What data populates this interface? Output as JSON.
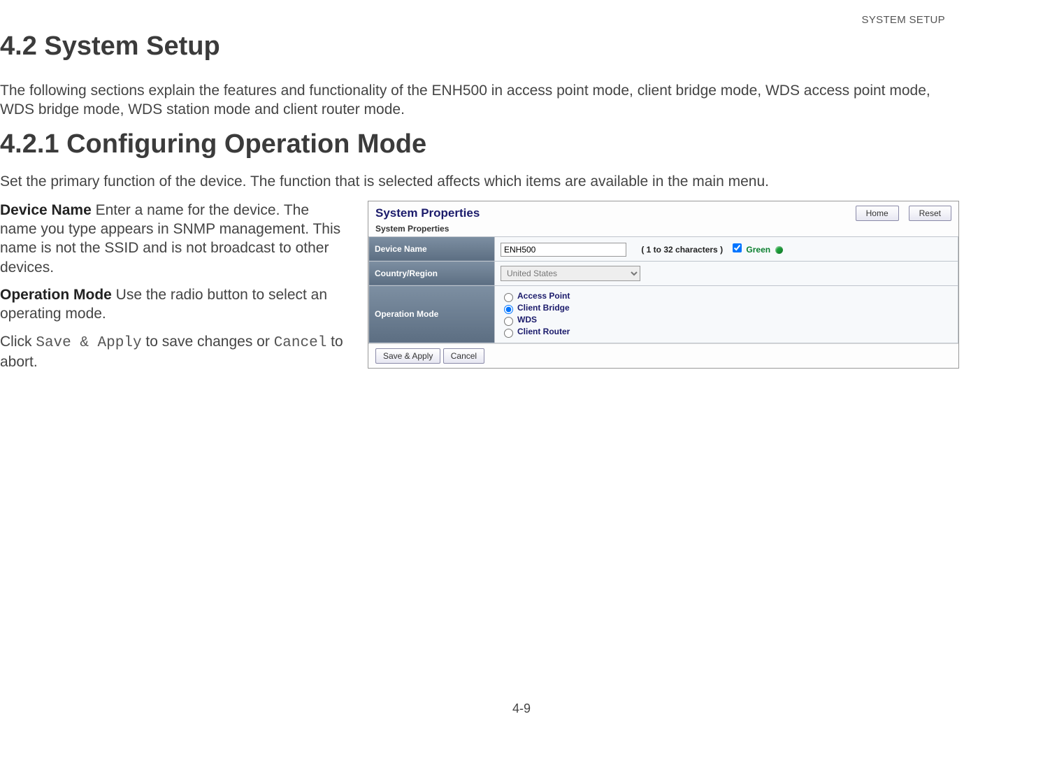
{
  "header": {
    "running_head": "SYSTEM SETUP"
  },
  "section": {
    "number_title": "4.2 System Setup",
    "intro": "The following sections explain the features and functionality of the ENH500 in access point mode, client bridge mode, WDS access point mode, WDS bridge mode, WDS station mode and client router mode.",
    "sub_number_title": "4.2.1 Configuring Operation Mode",
    "sub_intro": "Set the primary function of the device. The function that is selected affects which items are available in the main menu."
  },
  "definitions": {
    "device_name_term": "Device Name",
    "device_name_text": "  Enter a name for the device. The name you type appears in SNMP management. This name is not the SSID and is not broadcast to other devices.",
    "operation_mode_term": "Operation Mode",
    "operation_mode_text": "  Use the radio button to select an operating mode.",
    "click_prefix": "Click ",
    "save_apply_mono": "Save & Apply",
    "click_mid": " to save changes or ",
    "cancel_mono": "Cancel",
    "click_suffix": " to abort."
  },
  "ui": {
    "panel_title": "System Properties",
    "top_buttons": {
      "home": "Home",
      "reset": "Reset"
    },
    "sub_header": "System Properties",
    "rows": {
      "device_name": {
        "label": "Device Name",
        "value": "ENH500",
        "hint": "( 1 to 32 characters )",
        "checkbox_checked": true,
        "green_label": "Green"
      },
      "country": {
        "label": "Country/Region",
        "value": "United States"
      },
      "op_mode": {
        "label": "Operation Mode",
        "options": [
          {
            "label": "Access Point",
            "checked": false
          },
          {
            "label": "Client Bridge",
            "checked": true
          },
          {
            "label": "WDS",
            "checked": false
          },
          {
            "label": "Client Router",
            "checked": false
          }
        ]
      }
    },
    "footer": {
      "save": "Save & Apply",
      "cancel": "Cancel"
    }
  },
  "page_number": "4-9"
}
